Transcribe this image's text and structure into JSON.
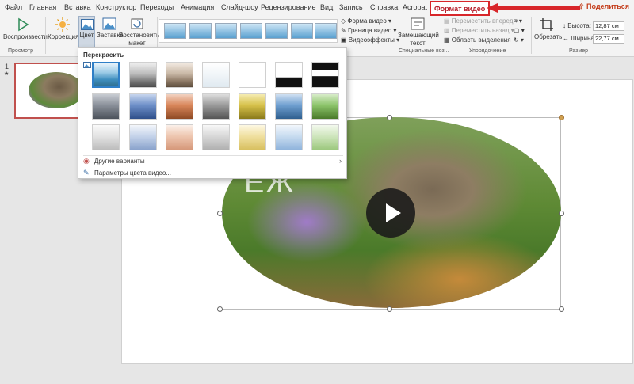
{
  "tabs": [
    {
      "label": "Файл"
    },
    {
      "label": "Главная"
    },
    {
      "label": "Вставка"
    },
    {
      "label": "Конструктор"
    },
    {
      "label": "Переходы"
    },
    {
      "label": "Анимация"
    },
    {
      "label": "Слайд-шоу"
    },
    {
      "label": "Рецензирование"
    },
    {
      "label": "Вид"
    },
    {
      "label": "Запись"
    },
    {
      "label": "Справка"
    },
    {
      "label": "Acrobat"
    },
    {
      "label": "Формат видео"
    }
  ],
  "share_label": "Поделиться",
  "ribbon": {
    "play_label": "Воспроизвести",
    "correction_label": "Коррекция",
    "color_label": "Цвет",
    "poster_label": "Заставка",
    "reset_label": "Восстановить макет",
    "video_shape_label": "Форма видео",
    "video_border_label": "Граница видео",
    "video_effects_label": "Видеоэффекты",
    "placeholder_text_label": "Замещающий текст",
    "bring_forward_label": "Переместить вперед",
    "send_backward_label": "Переместить назад",
    "selection_pane_label": "Область выделения",
    "crop_label": "Обрезать",
    "height_label": "Высота:",
    "height_value": "12,87 см",
    "width_label": "Ширина:",
    "width_value": "22,77 см",
    "group_preview": "Просмотр",
    "group_special": "Специальные воз...",
    "group_arrange": "Упорядочение",
    "group_size": "Размер"
  },
  "slide_panel": {
    "slide_number": "1",
    "star": "★"
  },
  "dropdown": {
    "title": "Перекрасить",
    "more_variants": "Другие варианты",
    "color_options": "Параметры цвета видео..."
  },
  "watermark_text": "ЁЖ",
  "colors": {
    "accent_red": "#d8262a",
    "selection_blue": "#2f7fc7",
    "ribbon_bg": "#f3f3f3"
  }
}
